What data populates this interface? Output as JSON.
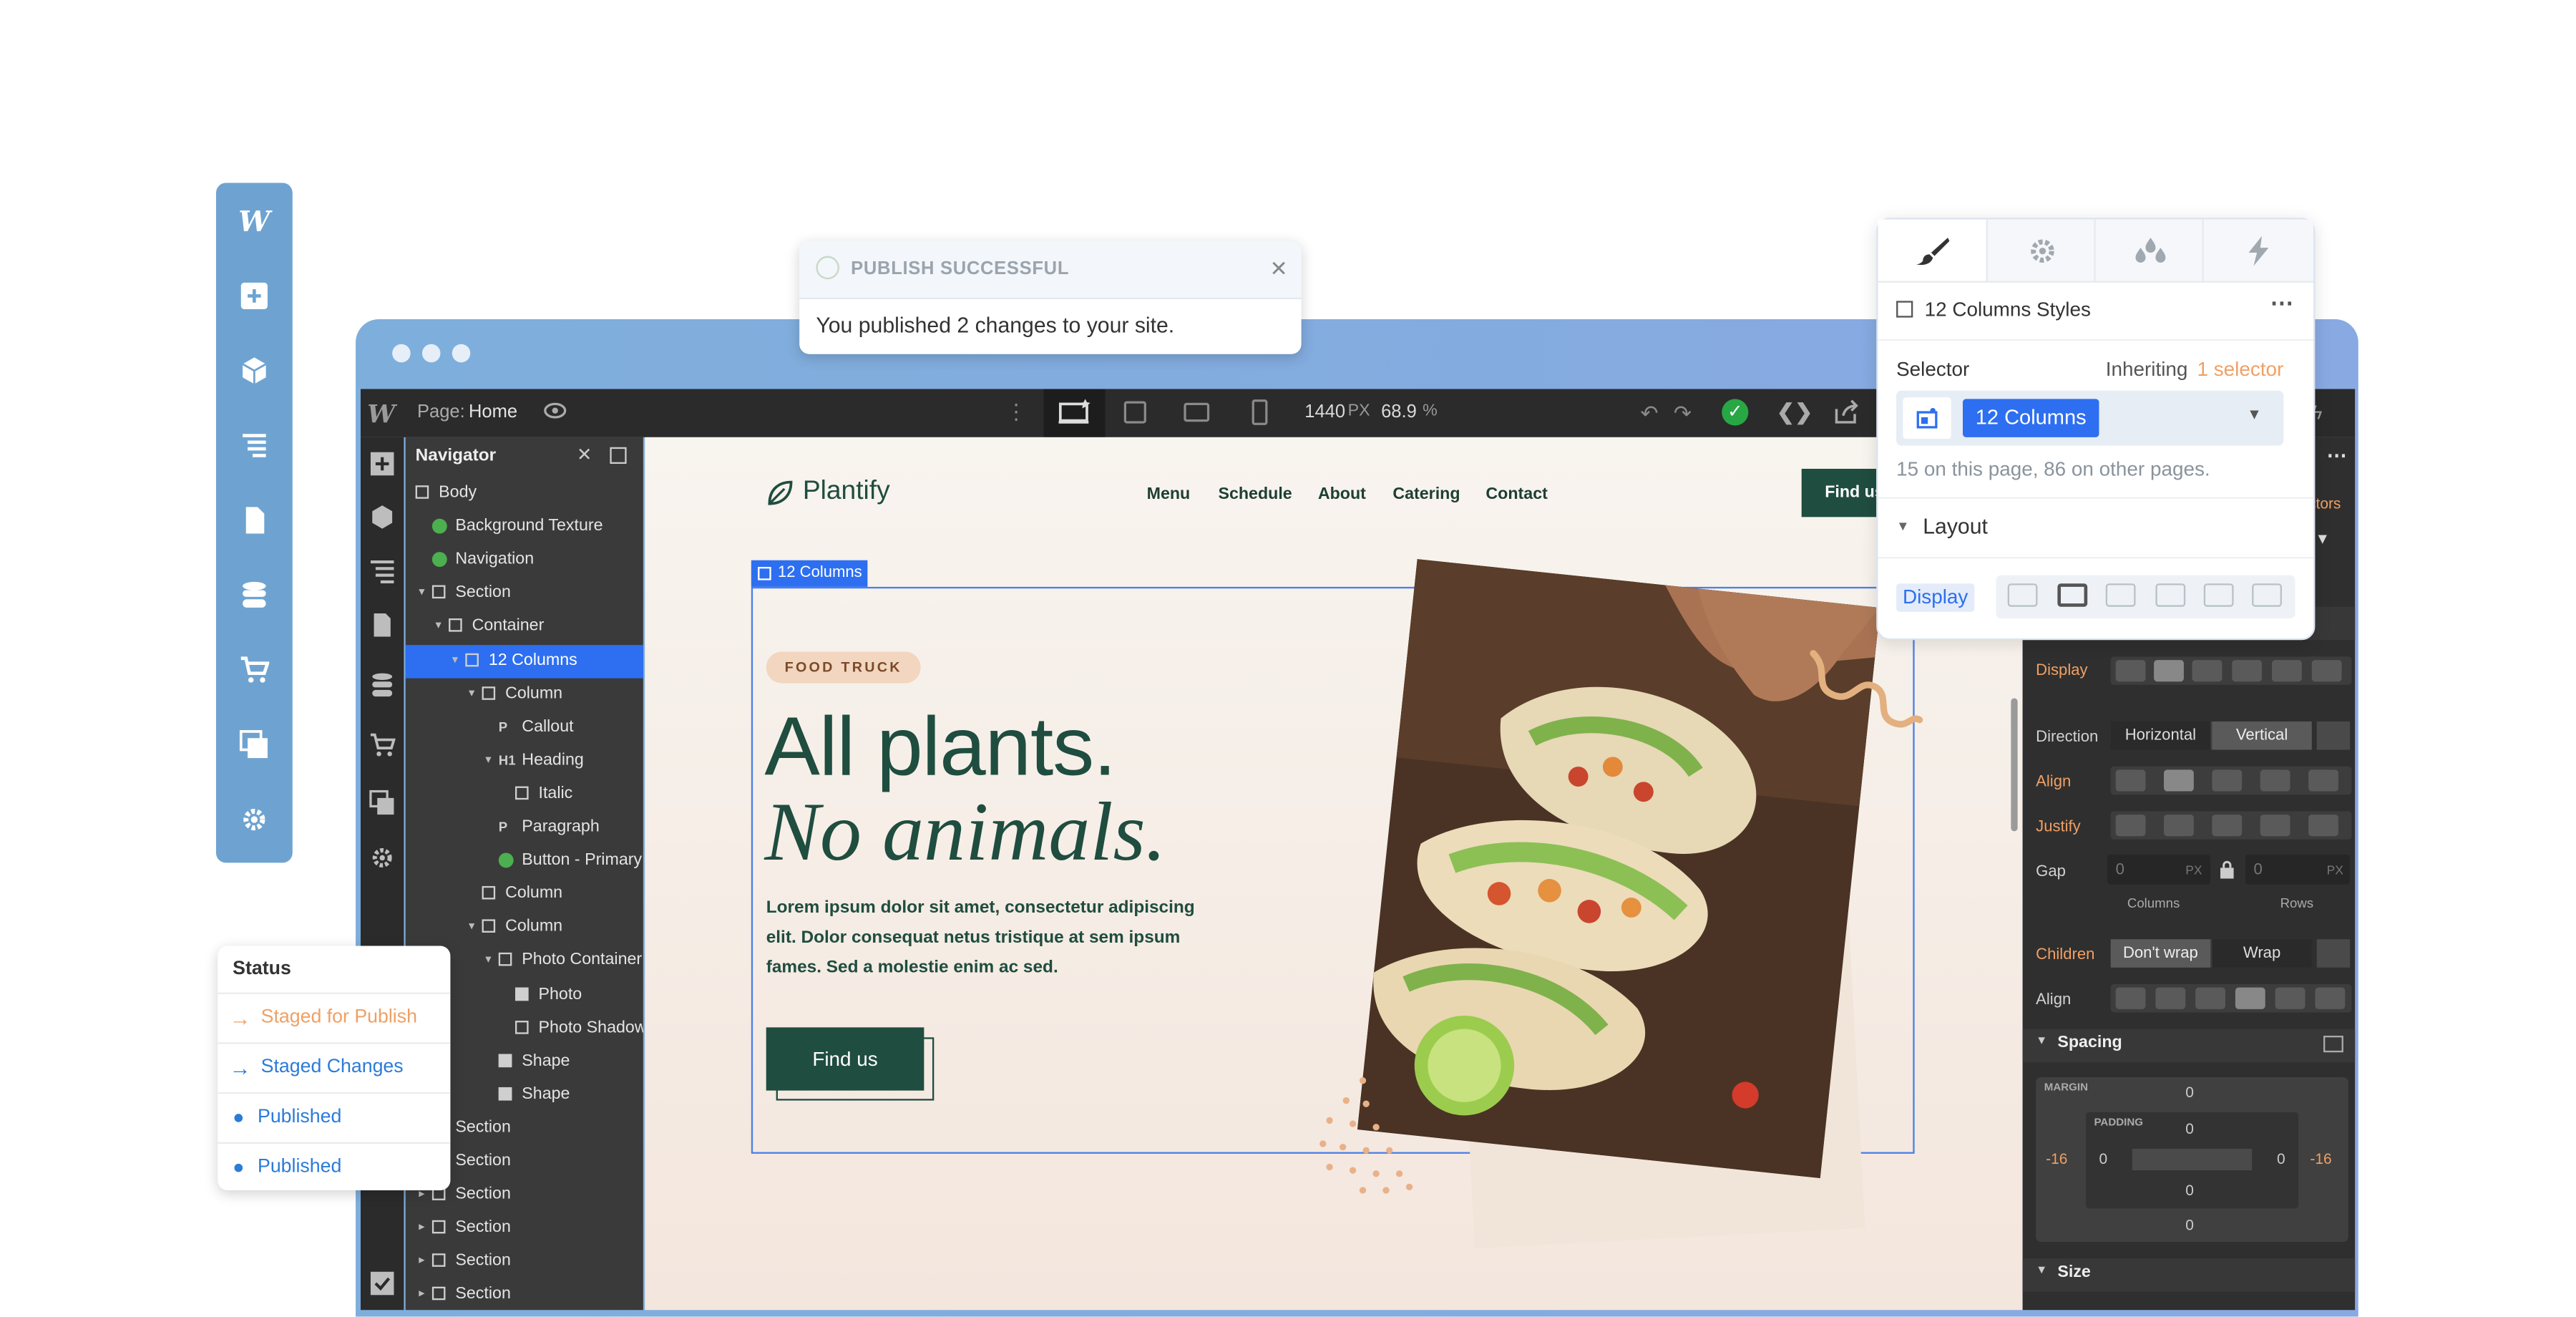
{
  "left_toolbar": {
    "icons": [
      "webflow-logo-icon",
      "add-icon",
      "box-icon",
      "navigator-icon",
      "pages-icon",
      "cms-icon",
      "ecommerce-icon",
      "assets-icon",
      "settings-icon"
    ],
    "logo": "W"
  },
  "window": {
    "designer_logo": "W",
    "page_label": "Page:",
    "page_name": "Home",
    "width_value": "1440",
    "width_unit": "PX",
    "zoom_value": "68.9",
    "zoom_unit": "%"
  },
  "navigator": {
    "title": "Navigator",
    "items": [
      {
        "label": "Body",
        "level": 0,
        "kind": "box",
        "tri": ""
      },
      {
        "label": "Background Texture",
        "level": 1,
        "kind": "symbol",
        "tri": ""
      },
      {
        "label": "Navigation",
        "level": 1,
        "kind": "symbol",
        "tri": ""
      },
      {
        "label": "Section",
        "level": 1,
        "kind": "box",
        "tri": "▾"
      },
      {
        "label": "Container",
        "level": 2,
        "kind": "box",
        "tri": "▾"
      },
      {
        "label": "12 Columns",
        "level": 3,
        "kind": "box",
        "tri": "▾",
        "selected": true
      },
      {
        "label": "Column",
        "level": 4,
        "kind": "box",
        "tri": "▾"
      },
      {
        "label": "Callout",
        "level": 5,
        "kind": "text",
        "prefix": "P",
        "tri": ""
      },
      {
        "label": "Heading",
        "level": 5,
        "kind": "text",
        "prefix": "H1",
        "tri": "▾"
      },
      {
        "label": "Italic",
        "level": 6,
        "kind": "box",
        "tri": ""
      },
      {
        "label": "Paragraph",
        "level": 5,
        "kind": "text",
        "prefix": "P",
        "tri": ""
      },
      {
        "label": "Button - Primary",
        "level": 5,
        "kind": "symbol",
        "tri": ""
      },
      {
        "label": "Column",
        "level": 4,
        "kind": "box",
        "tri": ""
      },
      {
        "label": "Column",
        "level": 4,
        "kind": "box",
        "tri": "▾"
      },
      {
        "label": "Photo Container",
        "level": 5,
        "kind": "box",
        "tri": "▾"
      },
      {
        "label": "Photo",
        "level": 6,
        "kind": "image",
        "tri": ""
      },
      {
        "label": "Photo Shadow",
        "level": 6,
        "kind": "box",
        "tri": ""
      },
      {
        "label": "Shape",
        "level": 5,
        "kind": "image",
        "tri": ""
      },
      {
        "label": "Shape",
        "level": 5,
        "kind": "image",
        "tri": ""
      },
      {
        "label": "Section",
        "level": 1,
        "kind": "box",
        "tri": "▸"
      },
      {
        "label": "Section",
        "level": 1,
        "kind": "box",
        "tri": "▸"
      },
      {
        "label": "Section",
        "level": 1,
        "kind": "box",
        "tri": "▸"
      },
      {
        "label": "Section",
        "level": 1,
        "kind": "box",
        "tri": "▸"
      },
      {
        "label": "Section",
        "level": 1,
        "kind": "box",
        "tri": "▸"
      },
      {
        "label": "Section",
        "level": 1,
        "kind": "box",
        "tri": "▸"
      }
    ]
  },
  "site": {
    "brand": "Plantify",
    "menu": [
      "Menu",
      "Schedule",
      "About",
      "Catering",
      "Contact"
    ],
    "cta_partial": "Find us",
    "selection_label": "12 Columns",
    "badge": "FOOD TRUCK",
    "heading_line1": "All plants.",
    "heading_line2": "No animals.",
    "paragraph": "Lorem ipsum dolor sit amet, consectetur adipiscing elit. Dolor consequat netus tristique at sem ipsum fames. Sed a molestie enim ac sed.",
    "button": "Find us"
  },
  "style_panel_dark": {
    "selectors_partial": "ctors",
    "display_label": "Display",
    "direction_label": "Direction",
    "direction_options": [
      "Horizontal",
      "Vertical"
    ],
    "align_label": "Align",
    "justify_label": "Justify",
    "gap_label": "Gap",
    "gap_columns_value": "0",
    "gap_rows_value": "0",
    "gap_unit": "PX",
    "columns_caption": "Columns",
    "rows_caption": "Rows",
    "children_label": "Children",
    "children_options": [
      "Don't wrap",
      "Wrap"
    ],
    "align2_label": "Align",
    "spacing_title": "Spacing",
    "margin_label": "MARGIN",
    "padding_label": "PADDING",
    "margin_top": "0",
    "margin_bottom": "0",
    "margin_left": "-16",
    "margin_right": "-16",
    "padding_top": "0",
    "padding_bottom": "0",
    "padding_left": "0",
    "padding_right": "0",
    "size_title": "Size"
  },
  "status_popup": {
    "title": "Status",
    "items": [
      {
        "label": "Staged for Publish",
        "color": "#f0a064",
        "icon": "arrow-right-icon"
      },
      {
        "label": "Staged Changes",
        "color": "#2b7bd8",
        "icon": "arrow-right-icon"
      },
      {
        "label": "Published",
        "color": "#2b7bd8",
        "icon": "dot-icon"
      },
      {
        "label": "Published",
        "color": "#2b7bd8",
        "icon": "dot-icon"
      }
    ]
  },
  "publish_toast": {
    "title": "PUBLISH SUCCESSFUL",
    "message": "You published 2 changes to your site."
  },
  "style_panel": {
    "tabs": [
      "brush-icon",
      "gear-icon",
      "drops-icon",
      "lightning-icon"
    ],
    "element_title": "12 Columns Styles",
    "selector_label": "Selector",
    "inheriting_label": "Inheriting",
    "inheriting_count": "1 selector",
    "selector_value": "12 Columns",
    "usage_note": "15 on this page, 86 on other pages.",
    "layout_title": "Layout",
    "display_label": "Display"
  },
  "colors": {
    "brand_green": "#1f4d3f",
    "selection_blue": "#2d6ff0",
    "toolbar_blue": "#6ea3d1",
    "accent_orange": "#f0a064"
  }
}
